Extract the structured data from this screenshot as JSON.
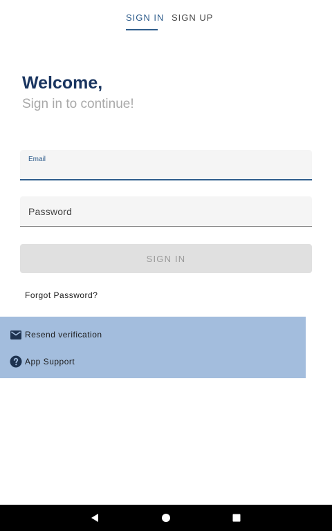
{
  "tabs": {
    "signin_label": "SIGN IN",
    "signup_label": "SIGN UP"
  },
  "heading": {
    "title": "Welcome,",
    "subtitle": "Sign in to continue!"
  },
  "form": {
    "email_label": "Email",
    "email_value": "",
    "password_label": "Password",
    "signin_button": "SIGN IN",
    "forgot_link": "Forgot Password?"
  },
  "support": {
    "resend_label": "Resend verification",
    "resend_icon": "mail-icon",
    "app_support_label": "App Support",
    "app_support_icon": "help-circle-icon"
  },
  "navbar": {
    "back_icon": "back-triangle-icon",
    "home_icon": "home-circle-icon",
    "recent_icon": "recents-square-icon"
  },
  "colors": {
    "accent": "#2f5d8c",
    "title": "#1a3560",
    "panel": "#a3bddd",
    "button_disabled": "#e0e0e0"
  }
}
